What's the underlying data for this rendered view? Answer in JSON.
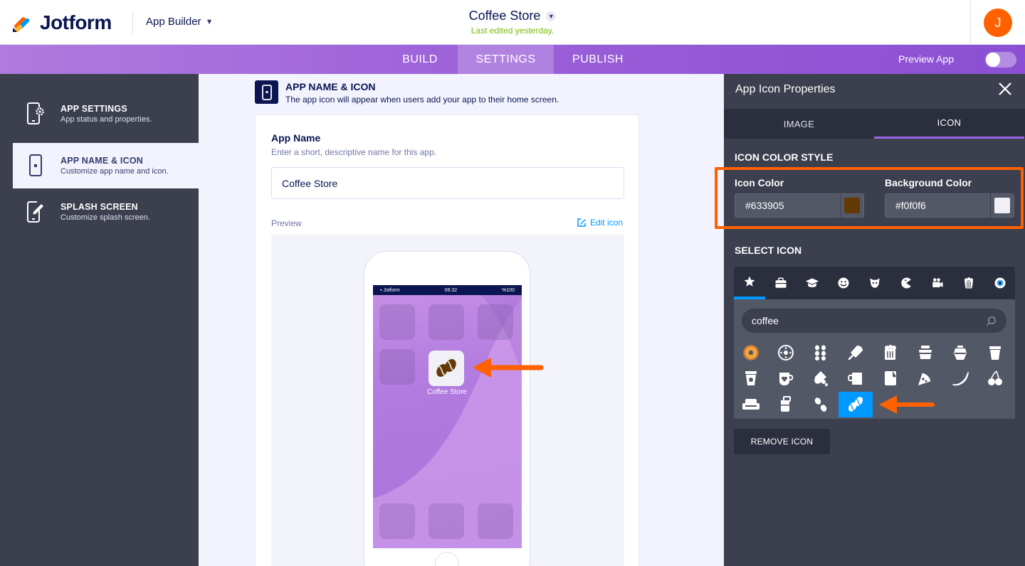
{
  "header": {
    "brand": "Jotform",
    "product": "App Builder",
    "app_title": "Coffee Store",
    "last_edited": "Last edited yesterday.",
    "avatar_initial": "J"
  },
  "nav": {
    "tabs": [
      {
        "label": "BUILD",
        "active": false
      },
      {
        "label": "SETTINGS",
        "active": true
      },
      {
        "label": "PUBLISH",
        "active": false
      }
    ],
    "preview_label": "Preview App",
    "preview_enabled": false
  },
  "sidebar": {
    "items": [
      {
        "title": "APP SETTINGS",
        "subtitle": "App status and properties.",
        "icon": "phone-gear-icon",
        "active": false
      },
      {
        "title": "APP NAME & ICON",
        "subtitle": "Customize app name and icon.",
        "icon": "phone-icon",
        "active": true
      },
      {
        "title": "SPLASH SCREEN",
        "subtitle": "Customize splash screen.",
        "icon": "phone-edit-icon",
        "active": false
      }
    ]
  },
  "main": {
    "section_title": "APP NAME & ICON",
    "section_subtitle": "The app icon will appear when users add your app to their home screen.",
    "app_name_label": "App Name",
    "app_name_hint": "Enter a short, descriptive name for this app.",
    "app_name_value": "Coffee Store",
    "preview_label": "Preview",
    "edit_icon_label": "Edit icon",
    "phone": {
      "carrier": "Jotform",
      "time": "06:32",
      "battery": "%100",
      "app_label": "Coffee Store"
    }
  },
  "panel": {
    "title": "App Icon Properties",
    "tabs": [
      {
        "label": "IMAGE",
        "active": false
      },
      {
        "label": "ICON",
        "active": true
      }
    ],
    "color_style_heading": "ICON COLOR STYLE",
    "icon_color_label": "Icon Color",
    "icon_color_value": "#633905",
    "background_color_label": "Background Color",
    "background_color_value": "#f0f0f6",
    "select_icon_heading": "SELECT ICON",
    "categories": [
      "star-icon",
      "briefcase-icon",
      "graduation-cap-icon",
      "smiley-icon",
      "animal-icon",
      "pacman-icon",
      "camera-icon",
      "popcorn-icon",
      "eye-icon"
    ],
    "search_value": "coffee",
    "result_icons": [
      "donut-icon",
      "cookie-icon",
      "coffee-beans-icon",
      "popsicle-icon",
      "beer-mug-icon",
      "coffee-pot-icon",
      "french-press-icon",
      "coffee-cup-icon",
      "takeaway-cup-icon",
      "heart-mug-icon",
      "bottle-icon",
      "mug-icon",
      "milk-box-icon",
      "pizza-icon",
      "banana-icon",
      "cherry-icon",
      "couch-icon",
      "glass-icon",
      "bean-pair-icon",
      "coffee-bean-selected-icon"
    ],
    "selected_icon": "coffee-bean-selected-icon",
    "remove_label": "REMOVE ICON"
  },
  "colors": {
    "accent_purple": "#9b5fd8",
    "highlight_orange": "#ff6100",
    "selection_blue": "#0099ff",
    "icon_color": "#633905",
    "icon_bg": "#f0f0f6"
  }
}
